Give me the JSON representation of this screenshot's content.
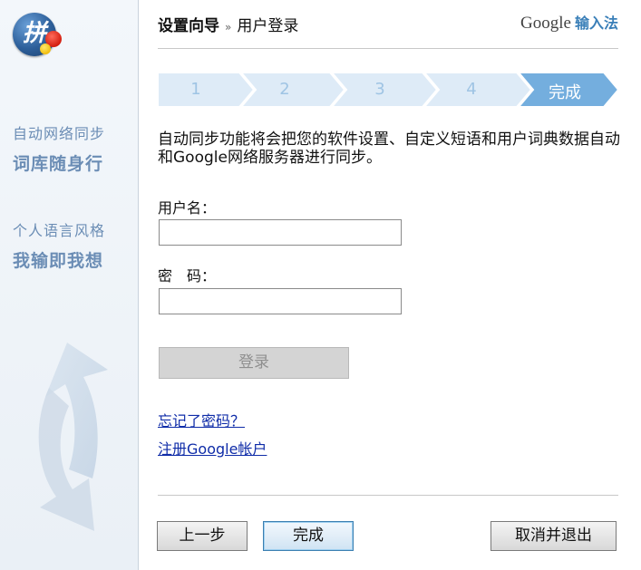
{
  "header": {
    "title": "设置向导",
    "separator": "»",
    "subtitle": "用户登录",
    "brand_google": "Google",
    "brand_product": "输入法"
  },
  "logo": {
    "glyph": "拼"
  },
  "sidebar": {
    "group1": {
      "line1": "自动网络同步",
      "line2": "词库随身行"
    },
    "group2": {
      "line1": "个人语言风格",
      "line2": "我输即我想"
    }
  },
  "steps": [
    {
      "label": "1",
      "active": false
    },
    {
      "label": "2",
      "active": false
    },
    {
      "label": "3",
      "active": false
    },
    {
      "label": "4",
      "active": false
    },
    {
      "label": "完成",
      "active": true
    }
  ],
  "description": "自动同步功能将会把您的软件设置、自定义短语和用户词典数据自动和Google网络服务器进行同步。",
  "form": {
    "username_label": "用户名：",
    "username_value": "",
    "password_label": "密　码：",
    "password_value": "",
    "login_button": "登录"
  },
  "links": {
    "forgot_password": "忘记了密码？",
    "register": "注册Google帐户"
  },
  "footer": {
    "prev_button": "上一步",
    "finish_button": "完成",
    "cancel_button": "取消并退出"
  },
  "colors": {
    "step_inactive": "#deebf7",
    "step_active": "#74aede",
    "link": "#0f2ca8",
    "sidebar_text": "#6b8db5"
  }
}
